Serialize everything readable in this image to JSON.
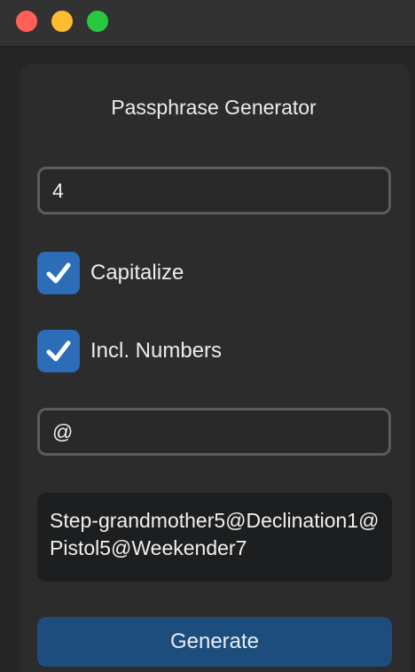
{
  "window": {
    "controls": [
      "close",
      "minimize",
      "zoom"
    ],
    "colors": {
      "close": "#ff5f57",
      "minimize": "#febc2e",
      "zoom": "#28c840"
    }
  },
  "app": {
    "title": "Passphrase Generator"
  },
  "form": {
    "word_count_value": "4",
    "capitalize": {
      "label": "Capitalize",
      "checked": true
    },
    "include_numbers": {
      "label": "Incl. Numbers",
      "checked": true
    },
    "separator_value": "@",
    "output": "Step-grandmother5@Declination1@Pistol5@Weekender7",
    "generate_label": "Generate"
  },
  "colors": {
    "accent": "#2d6db8",
    "button": "#1d4d7d"
  },
  "icons": {
    "checkbox_mark": "checkmark-icon"
  }
}
